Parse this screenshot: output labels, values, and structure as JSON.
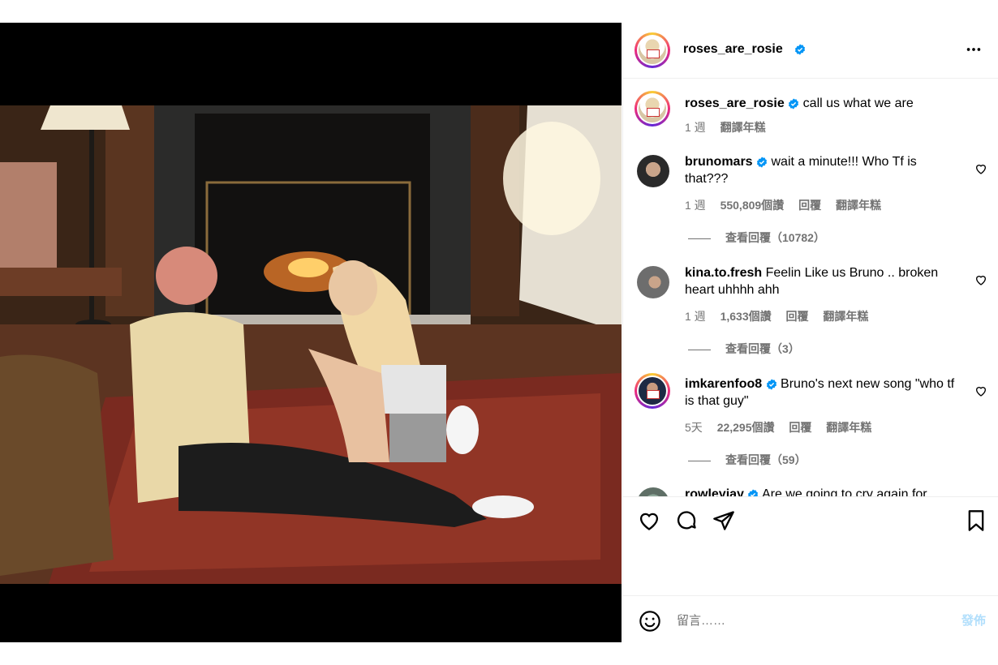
{
  "header": {
    "username": "roses_are_rosie",
    "verified": true,
    "more_icon": "more-horizontal-icon"
  },
  "caption": {
    "username": "roses_are_rosie",
    "text": "call us what we are",
    "time": "1 週",
    "translate": "翻譯年糕"
  },
  "comments": [
    {
      "username": "brunomars",
      "verified": true,
      "text": "wait a minute!!! Who Tf is that???",
      "time": "1 週",
      "likes": "550,809個讚",
      "reply": "回覆",
      "translate": "翻譯年糕",
      "view_replies": "查看回覆（10782）"
    },
    {
      "username": "kina.to.fresh",
      "verified": false,
      "text": "Feelin Like us Bruno .. broken heart uhhhh ahh",
      "time": "1 週",
      "likes": "1,633個讚",
      "reply": "回覆",
      "translate": "翻譯年糕",
      "view_replies": "查看回覆（3）"
    },
    {
      "username": "imkarenfoo8",
      "verified": true,
      "text": "Bruno's next new song \"who tf is that guy\"",
      "time": "5天",
      "likes": "22,295個讚",
      "reply": "回覆",
      "translate": "翻譯年糕",
      "view_replies": "查看回覆（59）"
    },
    {
      "username": "rowleyjay",
      "verified": true,
      "text": "Are we going to cry again for"
    }
  ],
  "composer": {
    "placeholder": "留言……",
    "post_label": "發佈"
  },
  "colors": {
    "accent": "#0095f6",
    "verified": "#0095f6",
    "muted": "#737373",
    "post_disabled": "#b2dffc"
  }
}
